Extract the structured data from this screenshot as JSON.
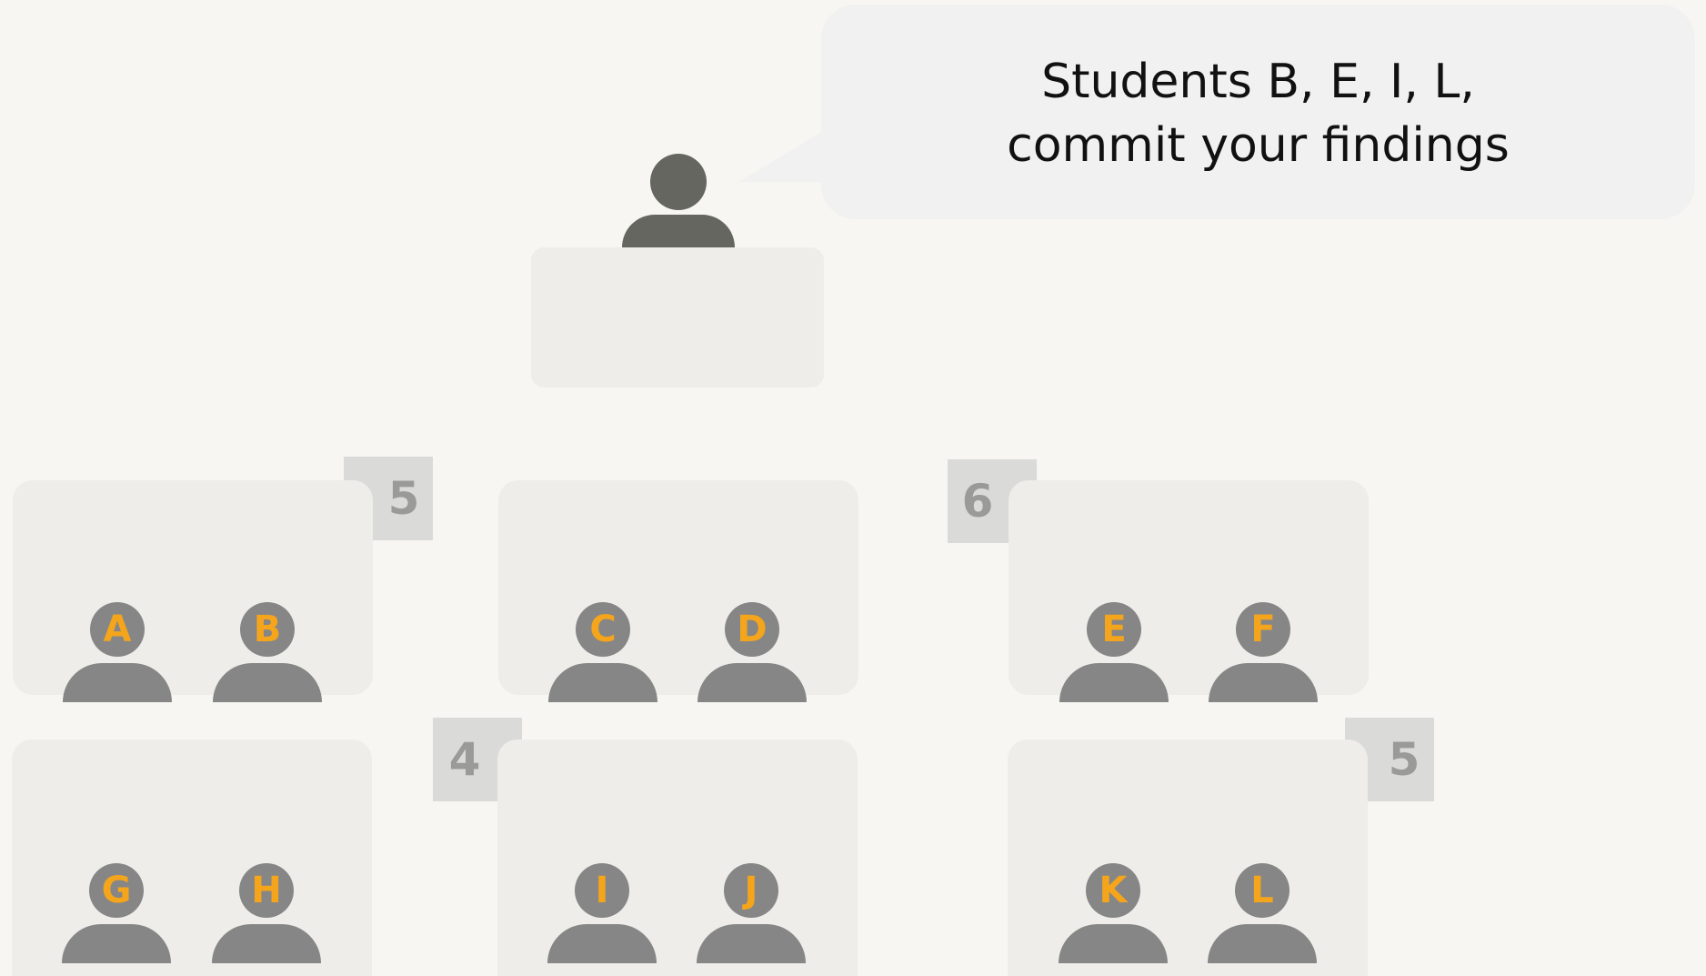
{
  "speech_bubble": {
    "lines": [
      "Students B, E, I, L,",
      "commit your findings"
    ]
  },
  "groups": [
    {
      "count": "5",
      "students": [
        "A",
        "B"
      ]
    },
    {
      "count": "",
      "students": [
        "C",
        "D"
      ]
    },
    {
      "count": "6",
      "students": [
        "E",
        "F"
      ]
    },
    {
      "count": "",
      "students": [
        "G",
        "H"
      ]
    },
    {
      "count": "4",
      "students": [
        "I",
        "J"
      ]
    },
    {
      "count": "5",
      "students": [
        "K",
        "L"
      ]
    }
  ],
  "colors": {
    "background": "#f7f6f2",
    "desk": "#eeede9",
    "person": "#868686",
    "teacher": "#666660",
    "student_letter": "#f4a51c",
    "count_box": "#dadad8",
    "count_text": "#9a9a98"
  }
}
